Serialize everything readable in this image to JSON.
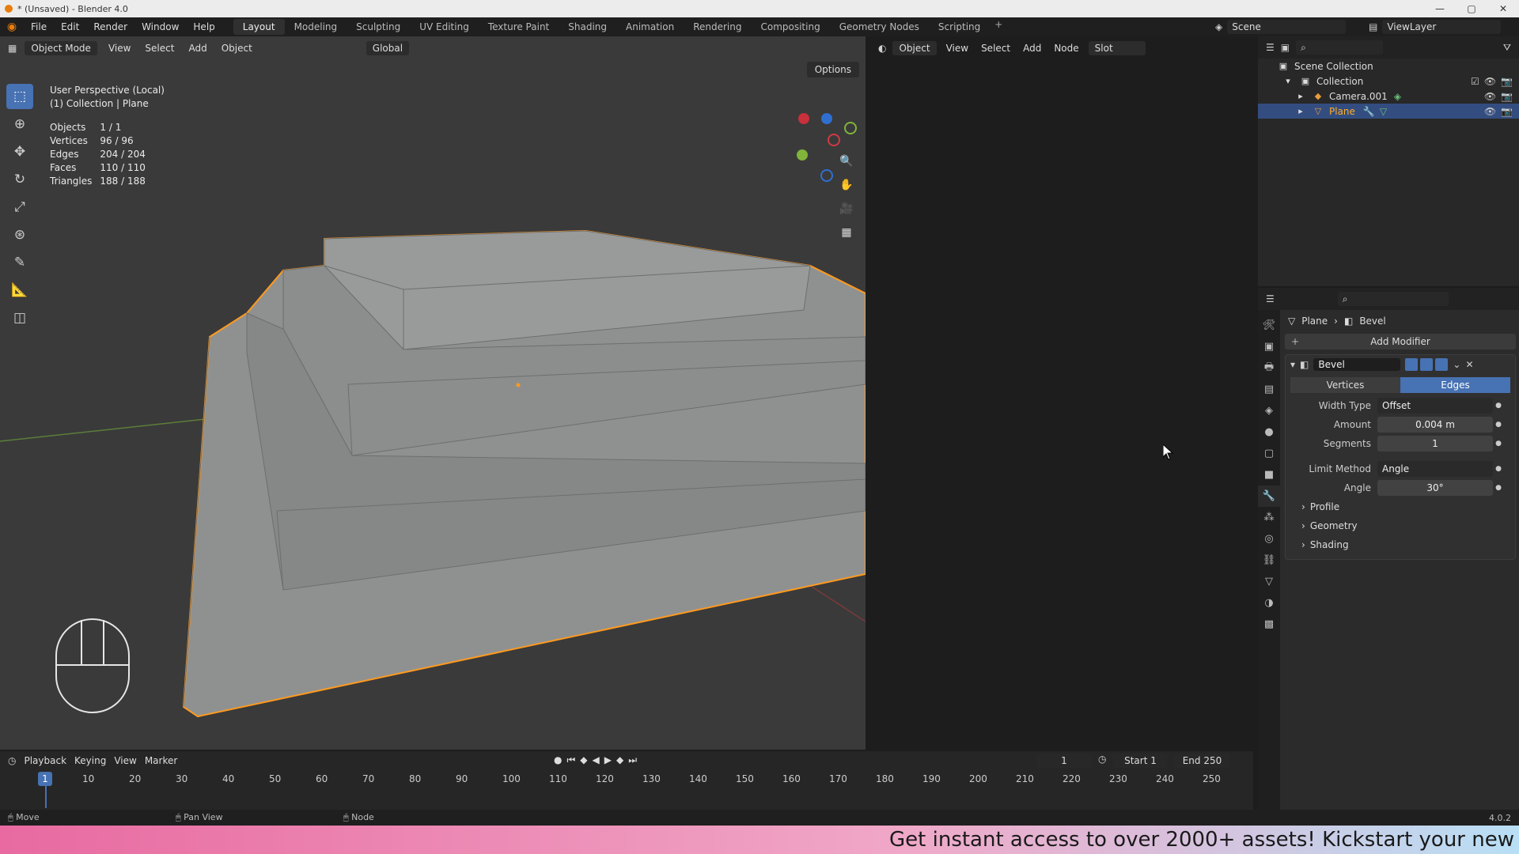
{
  "window": {
    "title": "* (Unsaved) - Blender 4.0",
    "controls": [
      "—",
      "▢",
      "✕"
    ]
  },
  "menu": [
    "File",
    "Edit",
    "Render",
    "Window",
    "Help"
  ],
  "workspaces": [
    "Layout",
    "Modeling",
    "Sculpting",
    "UV Editing",
    "Texture Paint",
    "Shading",
    "Animation",
    "Rendering",
    "Compositing",
    "Geometry Nodes",
    "Scripting"
  ],
  "scene": "Scene",
  "view_layer": "ViewLayer",
  "viewport": {
    "mode": "Object Mode",
    "menus": [
      "View",
      "Select",
      "Add",
      "Object"
    ],
    "orientation": "Global",
    "options": "Options",
    "info_line1": "User Perspective (Local)",
    "info_line2": "(1) Collection | Plane",
    "stats": [
      {
        "label": "Objects",
        "value": "1 / 1"
      },
      {
        "label": "Vertices",
        "value": "96 / 96"
      },
      {
        "label": "Edges",
        "value": "204 / 204"
      },
      {
        "label": "Faces",
        "value": "110 / 110"
      },
      {
        "label": "Triangles",
        "value": "188 / 188"
      }
    ],
    "gizmo_axes": [
      "Z",
      "Y"
    ],
    "colors": {
      "selection_outline": "#ff9a1f",
      "mesh_fill": "#8f9191",
      "grid_x": "#a33b3b",
      "grid_y": "#6f9b3a"
    }
  },
  "node_editor": {
    "type": "Object",
    "menus": [
      "View",
      "Select",
      "Add",
      "Node"
    ],
    "slot": "Slot"
  },
  "outliner": {
    "rows": [
      {
        "name": "Scene Collection",
        "indent": 0
      },
      {
        "name": "Collection",
        "indent": 1
      },
      {
        "name": "Camera.001",
        "indent": 2
      },
      {
        "name": "Plane",
        "indent": 2,
        "selected": true
      }
    ]
  },
  "properties": {
    "breadcrumb_object": "Plane",
    "breadcrumb_modifier": "Bevel",
    "add_modifier": "Add Modifier",
    "modifier_name": "Bevel",
    "mode_vertices": "Vertices",
    "mode_edges": "Edges",
    "fields": [
      {
        "label": "Width Type",
        "value": "Offset",
        "dropdown": true
      },
      {
        "label": "Amount",
        "value": "0.004 m"
      },
      {
        "label": "Segments",
        "value": "1"
      },
      {
        "label": "Limit Method",
        "value": "Angle",
        "dropdown": true
      },
      {
        "label": "Angle",
        "value": "30°"
      }
    ],
    "subpanels": [
      "Profile",
      "Geometry",
      "Shading"
    ]
  },
  "timeline": {
    "menus": [
      "Playback",
      "Keying",
      "View",
      "Marker"
    ],
    "current_frame": "1",
    "start_label": "Start",
    "start": "1",
    "end_label": "End",
    "end": "250",
    "ticks": [
      "10",
      "20",
      "30",
      "40",
      "50",
      "60",
      "70",
      "80",
      "90",
      "100",
      "110",
      "120",
      "130",
      "140",
      "150",
      "160",
      "170",
      "180",
      "190",
      "200",
      "210",
      "220",
      "230",
      "240",
      "250"
    ]
  },
  "statusbar": {
    "left": "Move",
    "middle": "Pan View",
    "right": "Node",
    "version": "4.0.2"
  },
  "banner": "Get instant access to over 2000+ assets! Kickstart your new"
}
